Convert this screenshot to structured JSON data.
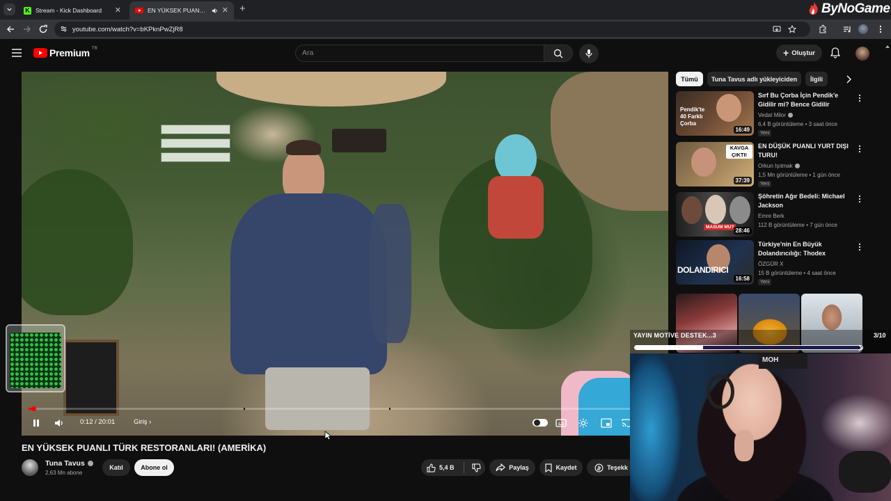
{
  "browser": {
    "tabs": [
      {
        "title": "Stream - Kick Dashboard",
        "icon": "kick-icon",
        "active": false
      },
      {
        "title": "EN YÜKSEK PUANLI TÜRK R",
        "icon": "youtube-icon",
        "active": true
      }
    ],
    "url": "youtube.com/watch?v=bKPknPwZjR8",
    "watermark": "ByNoGame"
  },
  "header": {
    "brand": "Premium",
    "region": "TR",
    "search_placeholder": "Ara",
    "create_label": "Oluştur"
  },
  "player": {
    "time": "0:12 / 20:01",
    "chapter": "Giriş",
    "progress_fraction": 0.01,
    "buffer_segments": [
      0.34,
      0.57
    ]
  },
  "video": {
    "title": "EN YÜKSEK PUANLI TÜRK RESTORANLARI! (AMERİKA)",
    "channel": "Tuna Tavus",
    "subscribers": "2,63 Mn abone",
    "join_label": "Katıl",
    "subscribe_label": "Abone ol",
    "likes": "5,4 B",
    "share_label": "Paylaş",
    "save_label": "Kaydet",
    "thanks_label": "Teşekk"
  },
  "sidebar": {
    "chips": [
      "Tümü",
      "Tuna Tavus adlı yükleyiciden",
      "İlgili"
    ],
    "recommendations": [
      {
        "title": "Sırf Bu Çorba İçin Pendik'e Gidilir mi? Bence Gidilir",
        "channel": "Vedat Milor",
        "verified": true,
        "meta": "6,4 B görüntüleme • 3 saat önce",
        "badge": "Yeni",
        "duration": "16:49",
        "thumb_text": "Pendik'te 40 Farklı Çorba"
      },
      {
        "title": "EN DÜŞÜK PUANLI YURT DIŞI TURU!",
        "channel": "Orkun Işıtmak",
        "verified": true,
        "meta": "1,5 Mn görüntüleme • 1 gün önce",
        "badge": "Yeni",
        "duration": "37:39",
        "thumb_text": "KAVGA ÇIKTI!"
      },
      {
        "title": "Şöhretin Ağır Bedeli: Michael Jackson",
        "channel": "Emre Berk",
        "verified": false,
        "meta": "112 B görüntüleme • 7 gün önce",
        "badge": "",
        "duration": "28:46",
        "thumb_text": "MASUM MU?"
      },
      {
        "title": "Türkiye'nin En Büyük Dolandırıcılığı: Thodex",
        "channel": "ÖZGÜR X",
        "verified": false,
        "meta": "15 B görüntüleme • 4 saat önce",
        "badge": "Yeni",
        "duration": "16:58",
        "thumb_text": "DOLANDIRICI"
      }
    ]
  },
  "overlay": {
    "goal_label": "YAYIN MOTİVE DESTEK...3",
    "goal_count": "3/10",
    "goal_fraction": 0.3,
    "hoodie_text": "MOH"
  },
  "colors": {
    "accent": "#ff0000",
    "background": "#0f0f0f",
    "chip_active": "#f1f1f1",
    "goal_track": "#1d1a4b"
  }
}
